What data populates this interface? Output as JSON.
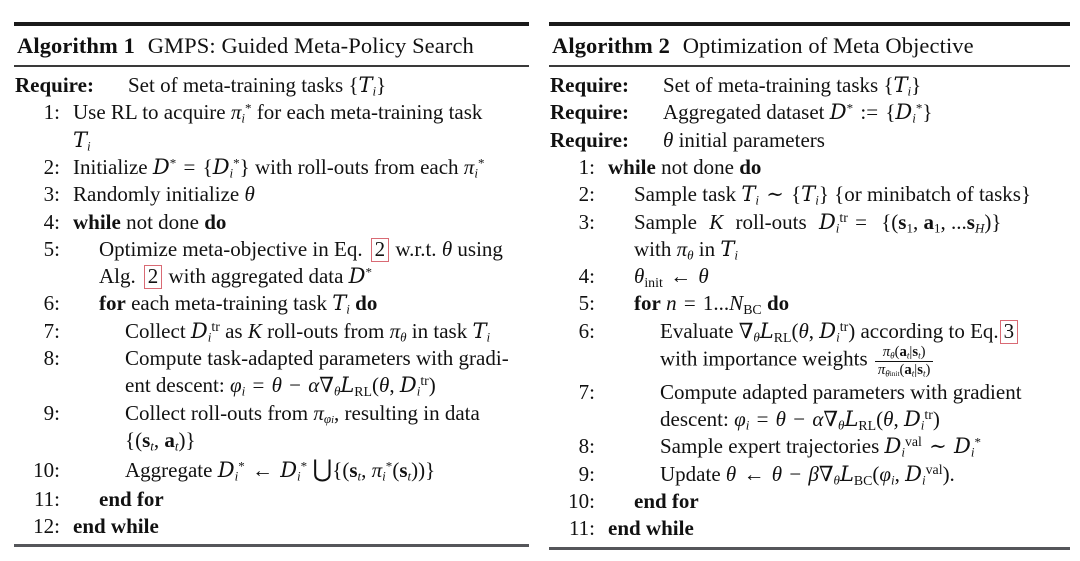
{
  "figure": {
    "type": "algorithm-pseudocode-pair",
    "background_color": "#ffffff",
    "text_color": "#111111",
    "ref_box_color": "#d96a74",
    "rule_color_top": "#1a1a1a",
    "rule_color_mid": "#3a3a3a",
    "rule_color_bottom": "#55565a"
  },
  "algorithm1": {
    "label": "Algorithm 1",
    "title": "GMPS: Guided Meta-Policy Search",
    "require": [
      {
        "keyword": "Require:",
        "text": "Set of meta-training tasks {T_i}"
      }
    ],
    "lines": [
      {
        "number": "1:",
        "indent": 0,
        "text": "Use RL to acquire π*_i for each meta-training task T_i"
      },
      {
        "number": "2:",
        "indent": 0,
        "text": "Initialize D* = {D*_i} with roll-outs from each π*_i"
      },
      {
        "number": "3:",
        "indent": 0,
        "text": "Randomly initialize θ"
      },
      {
        "number": "4:",
        "indent": 0,
        "text": "while not done do"
      },
      {
        "number": "5:",
        "indent": 1,
        "text": "Optimize meta-objective in Eq. 2 w.r.t. θ using Alg. 2 with aggregated data D*",
        "refs": [
          "2",
          "2"
        ]
      },
      {
        "number": "6:",
        "indent": 1,
        "text": "for each meta-training task T_i do"
      },
      {
        "number": "7:",
        "indent": 2,
        "text": "Collect D^tr_i as K roll-outs from π_θ in task T_i"
      },
      {
        "number": "8:",
        "indent": 2,
        "text": "Compute task-adapted parameters with gradient descent: φ_i = θ − α∇_θ L_RL(θ, D^tr_i)"
      },
      {
        "number": "9:",
        "indent": 2,
        "text": "Collect roll-outs from π_φi, resulting in data {(s_t, a_t)}"
      },
      {
        "number": "10:",
        "indent": 2,
        "text": "Aggregate D*_i ← D*_i ⋃{(s_t, π*_i(s_t))}"
      },
      {
        "number": "11:",
        "indent": 1,
        "text": "end for"
      },
      {
        "number": "12:",
        "indent": 0,
        "text": "end while"
      }
    ]
  },
  "algorithm2": {
    "label": "Algorithm 2",
    "title": "Optimization of Meta Objective",
    "require": [
      {
        "keyword": "Require:",
        "text": "Set of meta-training tasks {T_i}"
      },
      {
        "keyword": "Require:",
        "text": "Aggregated dataset D* := {D*_i}"
      },
      {
        "keyword": "Require:",
        "text": "θ initial parameters"
      }
    ],
    "lines": [
      {
        "number": "1:",
        "indent": 0,
        "text": "while not done do"
      },
      {
        "number": "2:",
        "indent": 1,
        "text": "Sample task T_i ~ {T_i} {or minibatch of tasks}"
      },
      {
        "number": "3:",
        "indent": 1,
        "text": "Sample K roll-outs D^tr_i = {(s_1, a_1, ...s_H)} with π_θ in T_i"
      },
      {
        "number": "4:",
        "indent": 1,
        "text": "θ_init ← θ"
      },
      {
        "number": "5:",
        "indent": 1,
        "text": "for n = 1...N_BC do"
      },
      {
        "number": "6:",
        "indent": 2,
        "text": "Evaluate ∇_θ L_RL(θ, D^tr_i) according to Eq. 3 with importance weights π_θ(a_t|s_t) / π_θinit(a_t|s_t)",
        "refs": [
          "3"
        ]
      },
      {
        "number": "7:",
        "indent": 2,
        "text": "Compute adapted parameters with gradient descent: φ_i = θ − α∇_θ L_RL(θ, D^tr_i)"
      },
      {
        "number": "8:",
        "indent": 2,
        "text": "Sample expert trajectories D^val_i ~ D*_i"
      },
      {
        "number": "9:",
        "indent": 2,
        "text": "Update θ ← θ − β∇_θ L_BC(φ_i, D^val_i)."
      },
      {
        "number": "10:",
        "indent": 1,
        "text": "end for"
      },
      {
        "number": "11:",
        "indent": 0,
        "text": "end while"
      }
    ]
  }
}
